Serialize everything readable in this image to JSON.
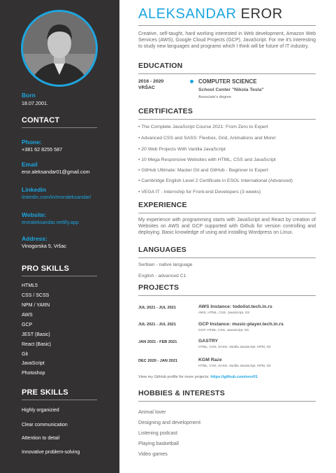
{
  "name": {
    "first": "ALEKSANDAR",
    "last": "EROR"
  },
  "sidebar": {
    "born_label": "Born",
    "born_value": "18.07.2001.",
    "contact_heading": "CONTACT",
    "phone_label": "Phone:",
    "phone_value": "+381 62 8255 587",
    "email_label": "Email",
    "email_value": "eror.aleksandar01@gmail.com",
    "linkedin_label": "Linkedin",
    "linkedin_value": "linkedin.com/in/eroraleksandar/",
    "website_label": "Website:",
    "website_value": "eroraleksandar.netlify.app",
    "address_label": "Address:",
    "address_value": "Vinogorska 5, Vršac",
    "pro_heading": "PRO SKILLS",
    "pro_skills": [
      "HTML5",
      "CSS / SCSS",
      "NPM / YARN",
      "AWS",
      "GCP",
      "JEST (Basic)",
      "React (Basic)",
      "Git",
      "JavaScript",
      "Photoshop"
    ],
    "pre_heading": "PRE SKILLS",
    "pre_skills": [
      "Highly organizied",
      "Clear communication",
      "Attention to detail",
      "Innovative problem-solving"
    ]
  },
  "main": {
    "summary": "Creative, self-taught, hard working interested in Web development, Amazon Web Services (AWS), Google Cloud Projects (GCP), JavaScript. For me it's interesting to study new languages and programs which I think will be future of IT industry.",
    "education_heading": "EDUCATION",
    "education": {
      "dates": "2016 - 2020",
      "place": "VRŠAC",
      "title": "COMPUTER SCIENCE",
      "school": "School Center \"Nikola Tesla\"",
      "degree": "Associate's degree"
    },
    "certificates_heading": "CERTIFICATES",
    "certificates": [
      "• The Complete JavaScript Course 2021: From Zero to Expert",
      "• Advanced CSS and SASS: Flexbox, Grid, Animations and More!",
      "• 20 Web Projects With Vanilla JavaScript",
      "• 10 Mega Responsive Websites with HTML, CSS and JavaScript",
      "• GitHub Ultimate: Master Git and GitHub - Beginner to Expert",
      "• Cambridge English Level 2 Certificate in ESOL International (Advanced)",
      "• VEGA IT - Internship for Front-end Developers (3 weeks)"
    ],
    "experience_heading": "EXPERIENCE",
    "experience": "My experience with programming starts with JavaScript and React by creation of Websites on AWS and GCP supported with Github for version controlling and deploying. Basic knowledge of using and installing Wordpress on Linux.",
    "languages_heading": "LANGUAGES",
    "languages": [
      "Serbian - native language",
      "English - advanced C1"
    ],
    "projects_heading": "PROJECTS",
    "projects": [
      {
        "dates": "JUL 2021 - JUL 2021",
        "title": "AWS Instance: todolist.tech.in.rs",
        "tech": "AWS, HTML, CSS, JavaScript, Git"
      },
      {
        "dates": "JUL 2021 - JUL 2021",
        "title": "GCP Instance: music-player.tech.in.rs",
        "tech": "GCP, HTML, CSS, JavaScript, Git"
      },
      {
        "dates": "JAN 2021 - FEB 2021",
        "title": "GASTRY",
        "tech": "HTML, CSS, SASS, Vanilla JavaScript, NPM, Git"
      },
      {
        "dates": "DEC 2020 - JAN 2021",
        "title": "KGM Raze",
        "tech": "HTML, CSS, SASS, Vanilla JavaScript, NPM, Git"
      }
    ],
    "github_note": "View my GitHub profile for more projects: ",
    "github_link": "https://github.com/eror01",
    "hobbies_heading": "HOBBIES & INTERESTS",
    "hobbies": [
      "Animal lover",
      "Designing and development",
      "Listening podcast",
      "Playing basketball",
      "Video games"
    ]
  },
  "colors": {
    "accent": "#1ca6e0",
    "sidebar": "#333132"
  }
}
